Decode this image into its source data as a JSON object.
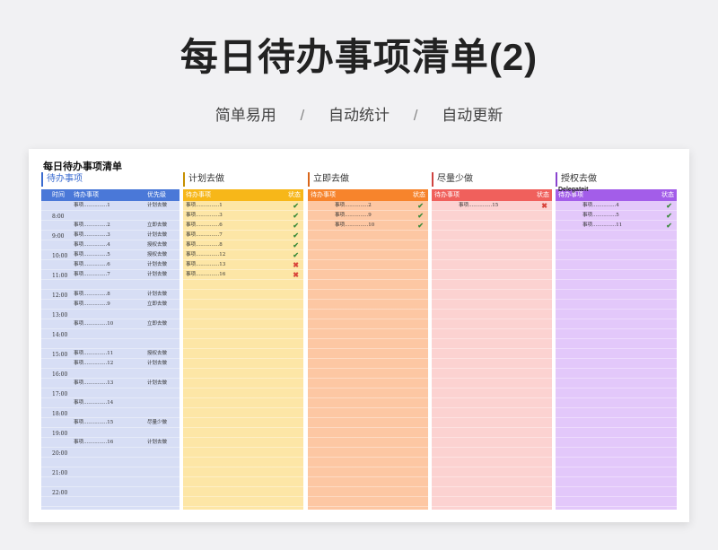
{
  "header": {
    "title": "每日待办事项清单(2)",
    "tags": [
      "简单易用",
      "自动统计",
      "自动更新"
    ]
  },
  "sheet": {
    "title": "每日待办事项清单",
    "schedule": {
      "heading": "待办事项",
      "col_time": "时间",
      "col_task": "待办事项",
      "col_priority": "优先级",
      "times": [
        {
          "label": "8:00",
          "row": 1
        },
        {
          "label": "9:00",
          "row": 3
        },
        {
          "label": "10:00",
          "row": 5
        },
        {
          "label": "11:00",
          "row": 7
        },
        {
          "label": "12:00",
          "row": 9
        },
        {
          "label": "13:00",
          "row": 11
        },
        {
          "label": "14:00",
          "row": 13
        },
        {
          "label": "15:00",
          "row": 15
        },
        {
          "label": "16:00",
          "row": 17
        },
        {
          "label": "17:00",
          "row": 19
        },
        {
          "label": "18:00",
          "row": 21
        },
        {
          "label": "19:00",
          "row": 23
        },
        {
          "label": "20:00",
          "row": 25
        },
        {
          "label": "21:00",
          "row": 27
        },
        {
          "label": "22:00",
          "row": 29
        }
      ],
      "tasks": [
        {
          "row": 0,
          "task": "事项...............1",
          "priority": "计划去做"
        },
        {
          "row": 2,
          "task": "事项...............2",
          "priority": "立即去做"
        },
        {
          "row": 3,
          "task": "事项...............3",
          "priority": "计划去做"
        },
        {
          "row": 4,
          "task": "事项...............4",
          "priority": "授权去做"
        },
        {
          "row": 5,
          "task": "事项...............5",
          "priority": "授权去做"
        },
        {
          "row": 6,
          "task": "事项...............6",
          "priority": "计划去做"
        },
        {
          "row": 7,
          "task": "事项...............7",
          "priority": "计划去做"
        },
        {
          "row": 9,
          "task": "事项...............8",
          "priority": "计划去做"
        },
        {
          "row": 10,
          "task": "事项...............9",
          "priority": "立即去做"
        },
        {
          "row": 12,
          "task": "事项...............10",
          "priority": "立即去做"
        },
        {
          "row": 15,
          "task": "事项...............11",
          "priority": "授权去做"
        },
        {
          "row": 16,
          "task": "事项...............12",
          "priority": "计划去做"
        },
        {
          "row": 18,
          "task": "事项...............13",
          "priority": "计划去做"
        },
        {
          "row": 20,
          "task": "事项...............14",
          "priority": ""
        },
        {
          "row": 22,
          "task": "事项...............15",
          "priority": "尽量少做"
        },
        {
          "row": 24,
          "task": "事项...............16",
          "priority": "计划去做"
        }
      ]
    },
    "quadrants": [
      {
        "key": "plan",
        "heading": "计划去做",
        "bar_label": "待办事项",
        "status_label": "状态",
        "items": [
          {
            "task": "事项...............1",
            "status": "✔",
            "ok": true
          },
          {
            "task": "事项...............3",
            "status": "✔",
            "ok": true
          },
          {
            "task": "事项...............6",
            "status": "✔",
            "ok": true
          },
          {
            "task": "事项...............7",
            "status": "✔",
            "ok": true
          },
          {
            "task": "事项...............8",
            "status": "✔",
            "ok": true
          },
          {
            "task": "事项...............12",
            "status": "✔",
            "ok": true
          },
          {
            "task": "事项...............13",
            "status": "✖",
            "ok": false
          },
          {
            "task": "事项...............16",
            "status": "✖",
            "ok": false
          }
        ]
      },
      {
        "key": "now",
        "heading": "立即去做",
        "bar_label": "待办事项",
        "status_label": "状态",
        "items": [
          {
            "task": "事项...............2",
            "status": "✔",
            "ok": true
          },
          {
            "task": "事项...............9",
            "status": "✔",
            "ok": true
          },
          {
            "task": "事项...............10",
            "status": "✔",
            "ok": true
          }
        ]
      },
      {
        "key": "less",
        "heading": "尽量少做",
        "bar_label": "待办事项",
        "status_label": "状态",
        "items": [
          {
            "task": "事项...............15",
            "status": "✖",
            "ok": false
          }
        ]
      },
      {
        "key": "delegate",
        "heading": "授权去做",
        "bar_label": "待办事项",
        "status_label": "状态",
        "overlay": "Delegateit",
        "items": [
          {
            "task": "事项...............4",
            "status": "✔",
            "ok": true
          },
          {
            "task": "事项...............5",
            "status": "✔",
            "ok": true
          },
          {
            "task": "事项...............11",
            "status": "✔",
            "ok": true
          }
        ]
      }
    ],
    "colors": {
      "schedule_bar": "#4a78d8",
      "schedule_body": "#d7def5",
      "plan_bar": "#f7b719",
      "plan_body": "#fde6a6",
      "now_bar": "#f7842c",
      "now_body": "#fdc7a3",
      "less_bar": "#f0605c",
      "less_body": "#fcd2d1",
      "delegate_bar": "#a35de9",
      "delegate_body": "#e3c8fa"
    }
  }
}
